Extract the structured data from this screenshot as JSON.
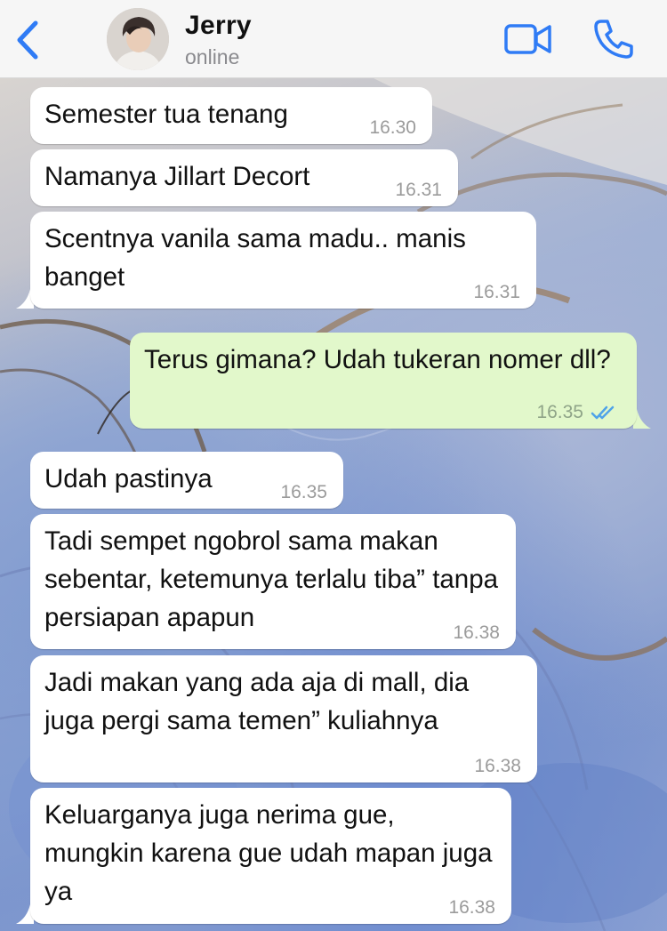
{
  "header": {
    "back_icon": "chevron-left-icon",
    "contact_name": "Jerry",
    "status": "online",
    "video_icon": "video-camera-icon",
    "call_icon": "phone-icon",
    "accent_color": "#2f7bf5"
  },
  "messages": [
    {
      "direction": "incoming",
      "text": "Semester tua tenang",
      "time": "16.30"
    },
    {
      "direction": "incoming",
      "text": "Namanya Jillart Decort",
      "time": "16.31"
    },
    {
      "direction": "incoming",
      "text": "Scentnya vanila sama madu.. manis banget",
      "time": "16.31"
    },
    {
      "direction": "outgoing",
      "text": "Terus gimana? Udah tukeran nomer dll?",
      "time": "16.35",
      "status_icon": "double-check-read-icon"
    },
    {
      "direction": "incoming",
      "text": "Udah pastinya",
      "time": "16.35"
    },
    {
      "direction": "incoming",
      "text": "Tadi sempet ngobrol sama makan sebentar, ketemunya terlalu tiba” tanpa persiapan apapun",
      "time": "16.38"
    },
    {
      "direction": "incoming",
      "text": "Jadi makan yang ada aja di mall, dia juga pergi sama temen” kuliahnya",
      "time": "16.38"
    },
    {
      "direction": "incoming",
      "text": "Keluarganya juga nerima gue, mungkin karena gue udah mapan juga ya",
      "time": "16.38"
    }
  ],
  "colors": {
    "incoming_bubble": "#ffffff",
    "outgoing_bubble": "#e2f8cb",
    "read_tick": "#4fa3e8"
  }
}
